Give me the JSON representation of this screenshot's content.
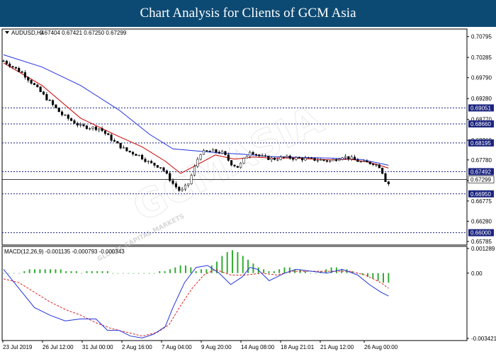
{
  "banner": {
    "title": "Chart Analysis for Clients of GCM Asia"
  },
  "chart_data": {
    "type": "candlestick",
    "symbol": "AUDUSD,H4",
    "ohlc_header": "0.67404 0.67421 0.67250 0.67299",
    "price_axis": {
      "ticks": [
        "0.70795",
        "0.70285",
        "0.69790",
        "0.69280",
        "0.68770",
        "0.68260",
        "0.67780",
        "0.67270",
        "0.66775",
        "0.66280",
        "0.65785"
      ],
      "range": [
        0.657,
        0.7098
      ]
    },
    "levels": [
      {
        "value": 0.69051,
        "label": "0.69051"
      },
      {
        "value": 0.6866,
        "label": "0.68660"
      },
      {
        "value": 0.68195,
        "label": "0.68195"
      },
      {
        "value": 0.67492,
        "label": "0.67492"
      },
      {
        "value": 0.6695,
        "label": "0.66950"
      },
      {
        "value": 0.66,
        "label": "0.66000"
      }
    ],
    "current_price": {
      "value": 0.67299,
      "label": "0.67299"
    },
    "x_ticks": [
      "23 Jul 2019",
      "26 Jul 12:00",
      "31 Jul 00:00",
      "2 Aug 16:00",
      "7 Aug 04:00",
      "9 Aug 20:00",
      "14 Aug 08:00",
      "18 Aug 21:01",
      "21 Aug 12:00",
      "26 Aug 00:00"
    ],
    "close_path": [
      [
        0,
        0.702
      ],
      [
        10,
        0.699
      ],
      [
        20,
        0.694
      ],
      [
        30,
        0.689
      ],
      [
        35,
        0.6875
      ],
      [
        40,
        0.686
      ],
      [
        50,
        0.6855
      ],
      [
        58,
        0.682
      ],
      [
        64,
        0.68
      ],
      [
        70,
        0.679
      ],
      [
        76,
        0.677
      ],
      [
        82,
        0.676
      ],
      [
        88,
        0.672
      ],
      [
        92,
        0.67
      ],
      [
        96,
        0.672
      ],
      [
        102,
        0.6795
      ],
      [
        108,
        0.68
      ],
      [
        114,
        0.6795
      ],
      [
        118,
        0.677
      ],
      [
        122,
        0.676
      ],
      [
        128,
        0.68
      ],
      [
        134,
        0.6785
      ],
      [
        140,
        0.678
      ],
      [
        146,
        0.6784
      ],
      [
        152,
        0.6782
      ],
      [
        158,
        0.678
      ],
      [
        164,
        0.6778
      ],
      [
        170,
        0.6775
      ],
      [
        176,
        0.6787
      ],
      [
        180,
        0.6782
      ],
      [
        186,
        0.6772
      ],
      [
        192,
        0.677
      ],
      [
        196,
        0.676
      ],
      [
        198,
        0.673
      ],
      [
        200,
        0.672
      ]
    ],
    "ma_fast": [
      [
        0,
        0.7015
      ],
      [
        20,
        0.696
      ],
      [
        40,
        0.688
      ],
      [
        60,
        0.6835
      ],
      [
        72,
        0.681
      ],
      [
        84,
        0.6775
      ],
      [
        92,
        0.6745
      ],
      [
        100,
        0.6765
      ],
      [
        110,
        0.679
      ],
      [
        120,
        0.678
      ],
      [
        130,
        0.6785
      ],
      [
        140,
        0.6782
      ],
      [
        150,
        0.6783
      ],
      [
        160,
        0.678
      ],
      [
        170,
        0.6778
      ],
      [
        180,
        0.678
      ],
      [
        190,
        0.6772
      ],
      [
        200,
        0.6758
      ]
    ],
    "ma_slow": [
      [
        0,
        0.7035
      ],
      [
        20,
        0.7005
      ],
      [
        40,
        0.696
      ],
      [
        60,
        0.69
      ],
      [
        76,
        0.684
      ],
      [
        88,
        0.6805
      ],
      [
        100,
        0.68
      ],
      [
        112,
        0.6795
      ],
      [
        124,
        0.6792
      ],
      [
        140,
        0.6786
      ],
      [
        156,
        0.6784
      ],
      [
        172,
        0.6782
      ],
      [
        186,
        0.6779
      ],
      [
        200,
        0.6765
      ]
    ],
    "macd": {
      "label": "MACD(12,26,9) -0.001135 -0.000793 -0.000343",
      "ticks": [
        "0.001289",
        "0.00",
        "-0.003421"
      ],
      "range": [
        -0.003421,
        0.001289
      ],
      "histogram": [
        0.0,
        0.0,
        0.0,
        0.0,
        0.0001,
        0.0002,
        0.0002,
        0.0002,
        0.0002,
        0.0002,
        0.0002,
        0.0002,
        0.0001,
        0.0001,
        0.0001,
        0.0,
        0.0001,
        0.0001,
        0.0001,
        0.0001,
        0.0001,
        0.0,
        0.0,
        0.0,
        0.0,
        0.0,
        0.0,
        0.0,
        0.0,
        0.0,
        0.0001,
        0.0001,
        0.0002,
        0.0003,
        0.0004,
        0.0004,
        0.0003,
        0.0001,
        0.0002,
        0.0002,
        0.0004,
        0.0006,
        0.0009,
        0.0011,
        0.0012,
        0.0011,
        0.0009,
        0.0007,
        0.0005,
        0.0003,
        0.0002,
        0.0001,
        0.0001,
        0.0002,
        0.0003,
        0.0003,
        0.0002,
        0.0002,
        0.0001,
        0.0,
        0.0,
        0.0001,
        0.0002,
        0.0003,
        0.0003,
        0.0002,
        0.0002,
        0.0001,
        0.0,
        -0.0001,
        -0.0002,
        -0.0003,
        -0.0004,
        -0.0005,
        -0.0005
      ],
      "macd_line": [
        [
          0,
          0.0002
        ],
        [
          8,
          -0.0008
        ],
        [
          16,
          -0.0018
        ],
        [
          24,
          -0.0022
        ],
        [
          32,
          -0.0025
        ],
        [
          40,
          -0.0024
        ],
        [
          48,
          -0.0024
        ],
        [
          54,
          -0.003
        ],
        [
          60,
          -0.003
        ],
        [
          66,
          -0.0033
        ],
        [
          72,
          -0.0034
        ],
        [
          78,
          -0.0032
        ],
        [
          84,
          -0.0028
        ],
        [
          88,
          -0.0018
        ],
        [
          94,
          -0.0005
        ],
        [
          100,
          0.0003
        ],
        [
          106,
          0.0004
        ],
        [
          112,
          0.0
        ],
        [
          118,
          -0.0006
        ],
        [
          124,
          -0.0002
        ],
        [
          128,
          0.0003
        ],
        [
          132,
          0.0002
        ],
        [
          138,
          -0.0004
        ],
        [
          146,
          0.0
        ],
        [
          152,
          0.0002
        ],
        [
          160,
          0.0001
        ],
        [
          168,
          0.0
        ],
        [
          176,
          0.0002
        ],
        [
          184,
          -0.0001
        ],
        [
          190,
          -0.0006
        ],
        [
          196,
          -0.001
        ],
        [
          200,
          -0.0012
        ]
      ],
      "signal_line": [
        [
          0,
          -0.0003
        ],
        [
          8,
          -0.0005
        ],
        [
          16,
          -0.001
        ],
        [
          24,
          -0.0015
        ],
        [
          32,
          -0.0019
        ],
        [
          40,
          -0.0022
        ],
        [
          48,
          -0.0026
        ],
        [
          56,
          -0.0029
        ],
        [
          64,
          -0.0031
        ],
        [
          72,
          -0.0033
        ],
        [
          80,
          -0.0031
        ],
        [
          86,
          -0.0027
        ],
        [
          92,
          -0.0017
        ],
        [
          98,
          -0.0008
        ],
        [
          104,
          -0.0001
        ],
        [
          110,
          0.0002
        ],
        [
          118,
          -0.0001
        ],
        [
          126,
          -0.0001
        ],
        [
          134,
          0.0
        ],
        [
          142,
          -0.0001
        ],
        [
          150,
          0.0001
        ],
        [
          160,
          0.0001
        ],
        [
          170,
          0.0001
        ],
        [
          180,
          0.0001
        ],
        [
          188,
          -0.0001
        ],
        [
          196,
          -0.0005
        ],
        [
          200,
          -0.0008
        ]
      ]
    },
    "colors": {
      "ma_fast": "#cc0000",
      "ma_slow": "#2233dd",
      "level_line": "#1a237e",
      "badge": "#1a237e",
      "macd_line": "#2233dd",
      "signal_line": "#dd2222",
      "histogram": "#33aa33",
      "current_badge": "#ffffff"
    }
  },
  "watermark": {
    "brand": "GCMASIA",
    "subtext": "GLOBAL CAPITAL MARKETS"
  }
}
